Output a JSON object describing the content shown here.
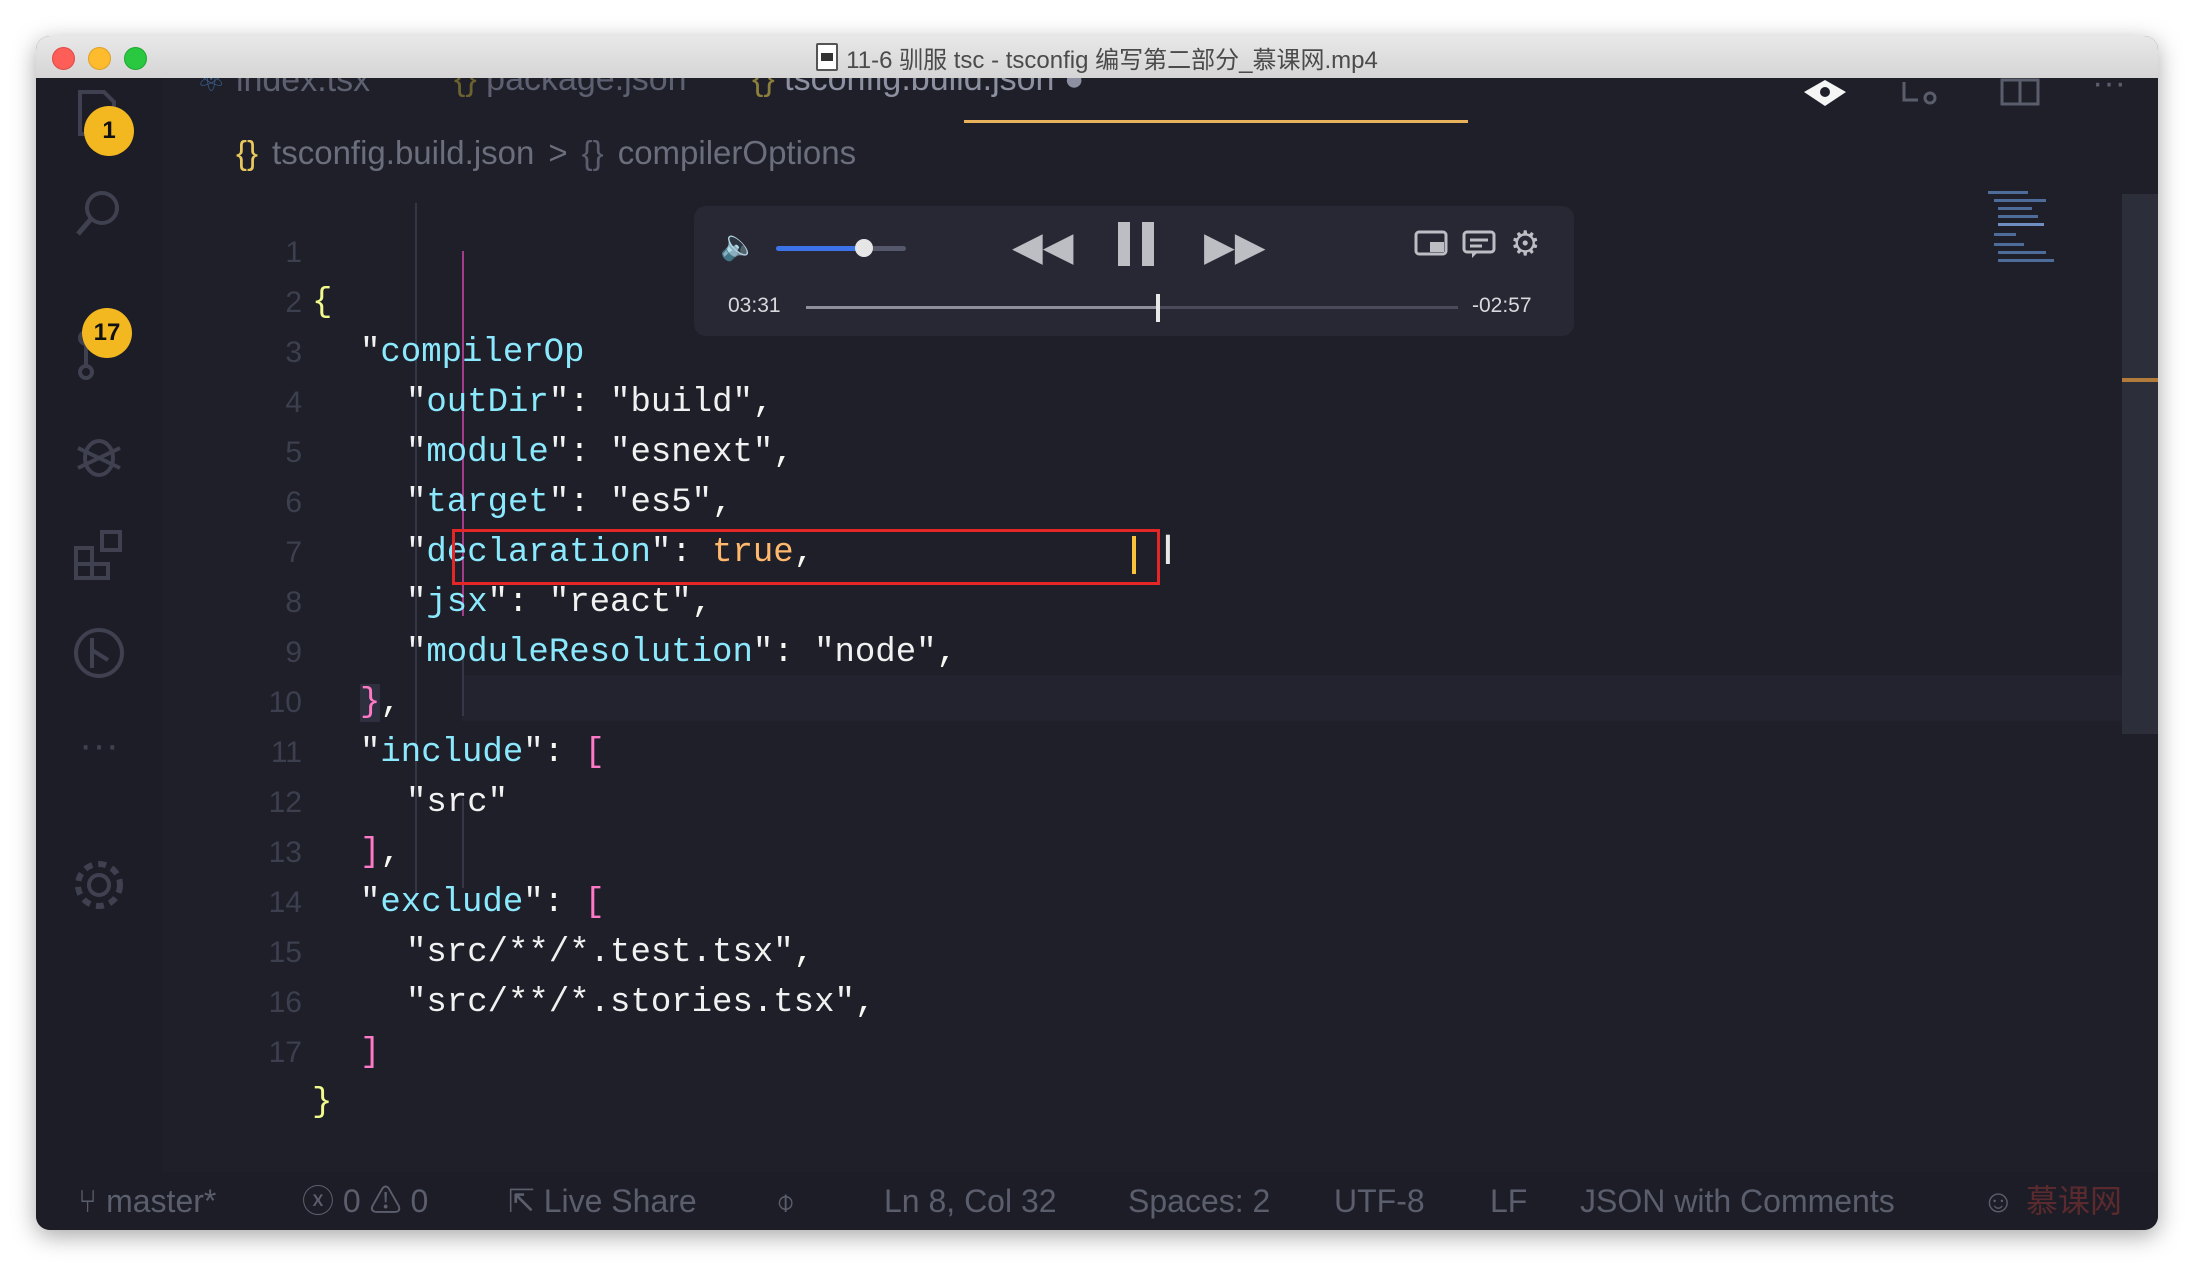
{
  "window": {
    "title": "11-6 驯服 tsc - tsconfig 编写第二部分_慕课网.mp4"
  },
  "activity_bar": {
    "badges": [
      "1",
      "17"
    ]
  },
  "tabs": [
    {
      "label": "index.tsx",
      "icon": "react-icon"
    },
    {
      "label": "package.json",
      "icon": "json-braces-icon"
    },
    {
      "label": "tsconfig.build.json",
      "icon": "json-braces-icon",
      "active": true,
      "modified": true
    }
  ],
  "breadcrumb": {
    "file": "tsconfig.build.json",
    "symbol": "compilerOptions"
  },
  "editor": {
    "lines": [
      "1",
      "2",
      "3",
      "4",
      "5",
      "6",
      "7",
      "8",
      "9",
      "10",
      "11",
      "12",
      "13",
      "14",
      "15",
      "16",
      "17"
    ],
    "line2_key": "compilerOp",
    "l3": {
      "key": "outDir",
      "value": "build"
    },
    "l4": {
      "key": "module",
      "value": "esnext"
    },
    "l5": {
      "key": "target",
      "value": "es5"
    },
    "l6": {
      "key": "declaration",
      "value": "true"
    },
    "l7": {
      "key": "jsx",
      "value": "react"
    },
    "l8": {
      "key": "moduleResolution",
      "value": "node"
    },
    "l10": {
      "key": "include"
    },
    "l11": {
      "value": "src"
    },
    "l13": {
      "key": "exclude"
    },
    "l14": {
      "value": "src/**/*.test.tsx"
    },
    "l15": {
      "value": "src/**/*.stories.tsx"
    }
  },
  "media_player": {
    "elapsed": "03:31",
    "remaining": "-02:57",
    "volume_fraction": 0.68,
    "progress_fraction": 0.54,
    "state": "playing"
  },
  "status_bar": {
    "branch": "master*",
    "errors": "0",
    "warnings": "0",
    "live_share": "Live Share",
    "position": "Ln 8, Col 32",
    "spaces": "Spaces: 2",
    "encoding": "UTF-8",
    "eol": "LF",
    "language": "JSON with Comments",
    "watermark": "慕课网"
  },
  "colors": {
    "editor_bg": "#1e1f29",
    "badge": "#f3b71f",
    "highlight_box": "#e52626",
    "active_tab_underline": "#e7b25b",
    "key": "#8be9fd",
    "boolean": "#ffb86c",
    "bracket": "#ff79c6"
  }
}
